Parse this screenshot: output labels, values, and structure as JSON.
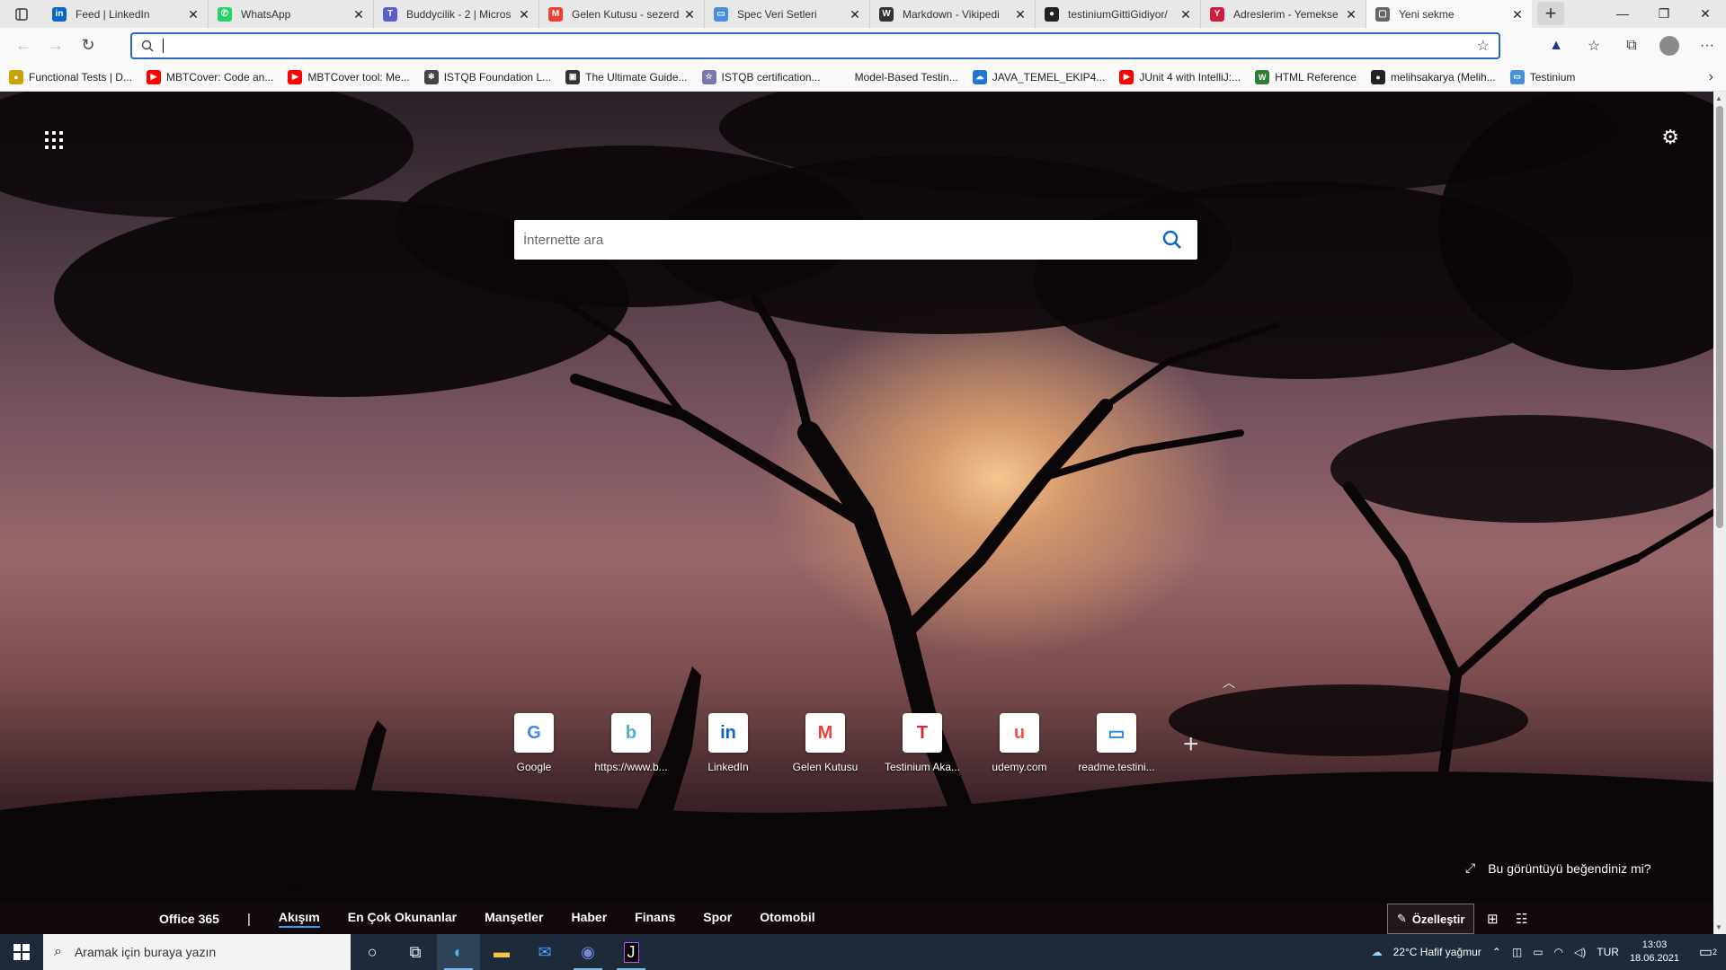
{
  "tabs": [
    {
      "title": "Feed | LinkedIn",
      "icon": "linkedin-icon",
      "color": "#0a66c2",
      "glyph": "in"
    },
    {
      "title": "WhatsApp",
      "icon": "whatsapp-icon",
      "color": "#25d366",
      "glyph": "✆"
    },
    {
      "title": "Buddycilik - 2 | Micros",
      "icon": "teams-icon",
      "color": "#5b5fc7",
      "glyph": "T"
    },
    {
      "title": "Gelen Kutusu - sezerd",
      "icon": "gmail-icon",
      "color": "#ea4335",
      "glyph": "M"
    },
    {
      "title": "Spec Veri Setleri",
      "icon": "book-icon",
      "color": "#4a90d9",
      "glyph": "▭"
    },
    {
      "title": "Markdown - Vikipedi",
      "icon": "wikipedia-icon",
      "color": "#333333",
      "glyph": "W"
    },
    {
      "title": "testiniumGittiGidiyor/",
      "icon": "github-icon",
      "color": "#222222",
      "glyph": "●"
    },
    {
      "title": "Adreslerim - Yemekse",
      "icon": "yemeksepeti-icon",
      "color": "#d01f3c",
      "glyph": "Y"
    },
    {
      "title": "Yeni sekme",
      "icon": "newtab-icon",
      "color": "#666666",
      "glyph": "▢"
    }
  ],
  "bookmarks": [
    {
      "label": "Functional Tests | D...",
      "color": "#c9a400",
      "glyph": "●"
    },
    {
      "label": "MBTCover: Code an...",
      "color": "#ff0000",
      "glyph": "▶"
    },
    {
      "label": "MBTCover tool: Me...",
      "color": "#ff0000",
      "glyph": "▶"
    },
    {
      "label": "ISTQB Foundation L...",
      "color": "#444444",
      "glyph": "✻"
    },
    {
      "label": "The Ultimate Guide...",
      "color": "#333333",
      "glyph": "▣"
    },
    {
      "label": "ISTQB certification...",
      "color": "#7777aa",
      "glyph": "☆"
    },
    {
      "label": "Model-Based Testin...",
      "color": "#f9f9f9",
      "glyph": ""
    },
    {
      "label": "JAVA_TEMEL_EKIP4...",
      "color": "#1f74d1",
      "glyph": "☁"
    },
    {
      "label": "JUnit 4 with IntelliJ:...",
      "color": "#ff0000",
      "glyph": "▶"
    },
    {
      "label": "HTML Reference",
      "color": "#2e7d32",
      "glyph": "W"
    },
    {
      "label": "melihsakarya (Melih...",
      "color": "#222222",
      "glyph": "●"
    },
    {
      "label": "Testinium",
      "color": "#4a90d9",
      "glyph": "▭"
    }
  ],
  "search": {
    "placeholder": "İnternette ara"
  },
  "tiles": [
    {
      "label": "Google",
      "glyph": "G",
      "color": "#4285f4"
    },
    {
      "label": "https://www.b...",
      "glyph": "b",
      "color": "#4fb0c6"
    },
    {
      "label": "LinkedIn",
      "glyph": "in",
      "color": "#0a66c2"
    },
    {
      "label": "Gelen Kutusu",
      "glyph": "M",
      "color": "#ea4335"
    },
    {
      "label": "Testinium Aka...",
      "glyph": "T",
      "color": "#d7263d"
    },
    {
      "label": "udemy.com",
      "glyph": "u",
      "color": "#ec5252"
    },
    {
      "label": "readme.testini...",
      "glyph": "▭",
      "color": "#1e88e5"
    }
  ],
  "like_text": "Bu görüntüyü beğendiniz mi?",
  "feed": {
    "office": "Office 365",
    "sep": "|",
    "items": [
      "Akışım",
      "En Çok Okunanlar",
      "Manşetler",
      "Haber",
      "Finans",
      "Spor",
      "Otomobil"
    ],
    "active": "Akışım",
    "customize": "Özelleştir"
  },
  "taskbar": {
    "search_placeholder": "Aramak için buraya yazın",
    "weather": "22°C  Hafif yağmur",
    "lang": "TUR",
    "time": "13:03",
    "date": "18.06.2021",
    "notif_count": "2"
  }
}
